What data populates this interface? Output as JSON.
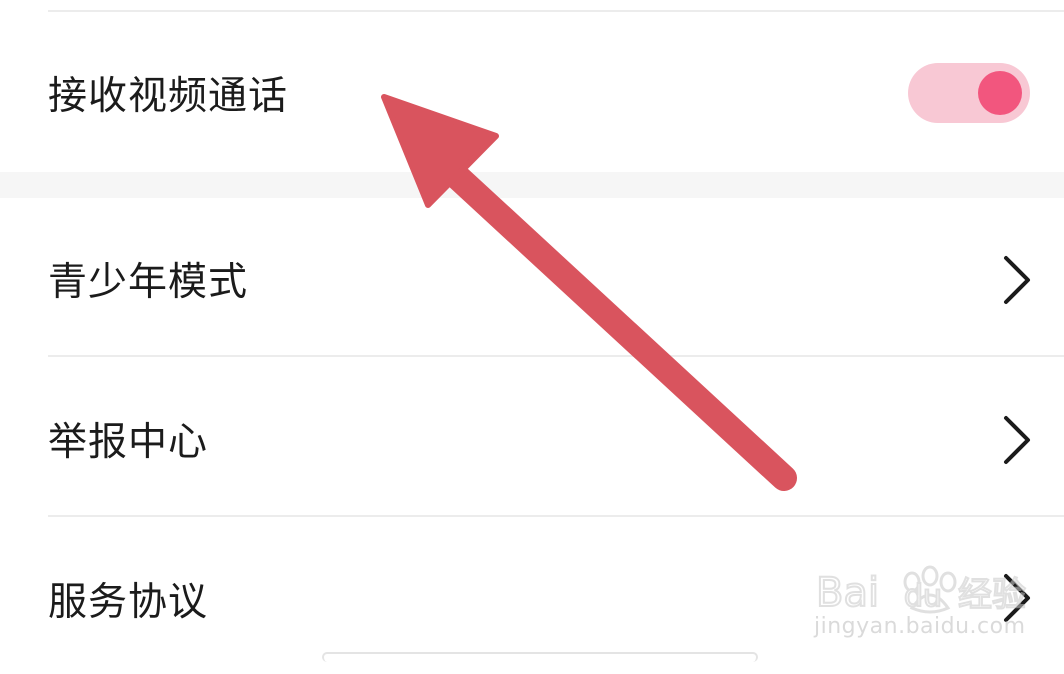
{
  "settings": {
    "items": [
      {
        "label": "接收视频通话",
        "control": "toggle",
        "toggle_on": true
      },
      {
        "label": "青少年模式",
        "control": "chevron"
      },
      {
        "label": "举报中心",
        "control": "chevron"
      },
      {
        "label": "服务协议",
        "control": "chevron"
      }
    ]
  },
  "icons": {
    "chevron": "chevron-right-icon",
    "arrow": "annotation-arrow"
  },
  "colors": {
    "toggle_track": "#f8c8d4",
    "toggle_knob": "#f2567e",
    "arrow": "#d9545e",
    "divider": "#ececec",
    "section_gap": "#f6f6f6"
  },
  "watermark": {
    "brand_text": "Bai du 经验",
    "url": "jingyan.baidu.com"
  }
}
